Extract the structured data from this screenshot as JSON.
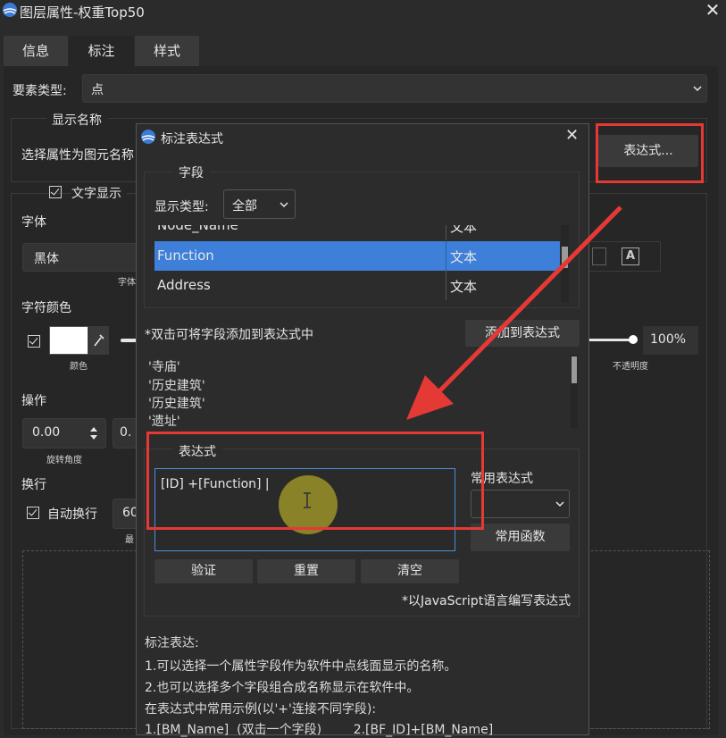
{
  "window": {
    "title": "图层属性-权重Top50",
    "close": "✕"
  },
  "tabs": [
    "信息",
    "标注",
    "样式"
  ],
  "main": {
    "feature_type_label": "要素类型:",
    "feature_type_value": "点",
    "display_name_section": "显示名称",
    "select_attr_label": "选择属性为图元名称",
    "expression_button": "表达式...",
    "text_display_label": "文字显示",
    "font_label": "字体",
    "font_value": "黑体",
    "font_sub": "字体",
    "char_color_label": "字符颜色",
    "color_sub": "颜色",
    "opacity_value": "100%",
    "opacity_sub": "不透明度",
    "operation_label": "操作",
    "rotation_value": "0.00",
    "rotation_sub": "旋转角度",
    "second_value_partial": "0.",
    "wrap_label": "换行",
    "auto_wrap_label": "自动换行",
    "wrap_value_partial": "60",
    "wrap_sub_partial": "最"
  },
  "dialog": {
    "title": "标注表达式",
    "close": "✕",
    "field_section": "字段",
    "display_type_label": "显示类型:",
    "display_type_value": "全部",
    "fields": [
      {
        "name": "Node_Name",
        "type": "文本"
      },
      {
        "name": "Function",
        "type": "文本"
      },
      {
        "name": "Address",
        "type": "文本"
      }
    ],
    "dblclick_hint": "*双击可将字段添加到表达式中",
    "add_button": "添加到表达式",
    "values": [
      "'寺庙'",
      "'历史建筑'",
      "'历史建筑'",
      "'遗址'"
    ],
    "expression_section": "表达式",
    "expression_text": "[ID] +[Function] |",
    "common_expr_label": "常用表达式",
    "common_expr_value": "",
    "common_func_button": "常用函数",
    "validate_button": "验证",
    "reset_button": "重置",
    "clear_button": "清空",
    "js_hint": "*以JavaScript语言编写表达式",
    "help": [
      "标注表达:",
      "1.可以选择一个属性字段作为软件中点线面显示的名称。",
      "2.也可以选择多个字段组合成名称显示在软件中。",
      "在表达式中常用示例(以'+'连接不同字段):",
      "1.[BM_Name]  (双击一个字段)        2.[BF_ID]+[BM_Name]"
    ]
  },
  "colors": {
    "accent": "#4a90d9",
    "highlight": "#e53935",
    "selected_row": "#3d7fd9"
  }
}
